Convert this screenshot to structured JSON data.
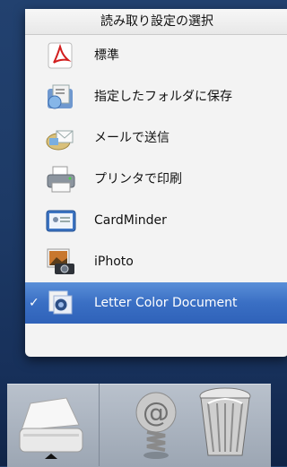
{
  "menu": {
    "title": "読み取り設定の選択",
    "items": [
      {
        "label": "標準",
        "icon": "pdf-icon",
        "selected": false
      },
      {
        "label": "指定したフォルダに保存",
        "icon": "folder-save-icon",
        "selected": false
      },
      {
        "label": "メールで送信",
        "icon": "mail-icon",
        "selected": false
      },
      {
        "label": "プリンタで印刷",
        "icon": "printer-icon",
        "selected": false
      },
      {
        "label": "CardMinder",
        "icon": "cardminder-icon",
        "selected": false
      },
      {
        "label": "iPhoto",
        "icon": "iphoto-icon",
        "selected": false
      },
      {
        "label": "Letter Color Document",
        "icon": "letter-color-document-icon",
        "selected": true
      }
    ],
    "checkmark": "✓",
    "selection_color": "#3a6fc4"
  },
  "dock": {
    "items": [
      {
        "icon": "scanner-icon"
      },
      {
        "icon": "mail-at-icon"
      },
      {
        "icon": "trash-icon"
      }
    ]
  }
}
